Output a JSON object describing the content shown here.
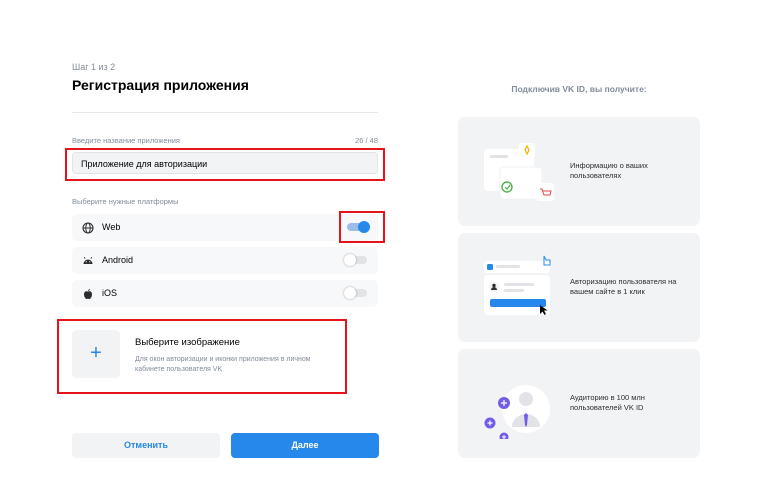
{
  "form": {
    "step": "Шаг 1 из 2",
    "title": "Регистрация приложения",
    "name_label": "Введите название приложения",
    "name_counter": "26 / 48",
    "name_value": "Приложение для авторизации",
    "platforms_label": "Выберите нужные платформы",
    "platforms": [
      {
        "label": "Web",
        "icon": "globe-icon",
        "enabled": true
      },
      {
        "label": "Android",
        "icon": "android-icon",
        "enabled": false
      },
      {
        "label": "iOS",
        "icon": "apple-icon",
        "enabled": false
      }
    ],
    "image": {
      "title": "Выберите изображение",
      "description": "Для окон авторизации и иконки приложения в личном кабинете пользователя VK",
      "add_icon": "+"
    },
    "cancel_label": "Отменить",
    "next_label": "Далее"
  },
  "benefits": {
    "heading": "Подключив VK ID, вы получите:",
    "items": [
      {
        "text": "Информацию о ваших пользователях"
      },
      {
        "text": "Авторизацию пользователя на вашем сайте в 1 клик"
      },
      {
        "text": "Аудиторию в 100 млн пользователей VK ID"
      }
    ]
  },
  "colors": {
    "accent": "#2688eb",
    "highlight": "#e5141a",
    "card_bg": "#f2f3f5",
    "muted": "#818c99"
  }
}
